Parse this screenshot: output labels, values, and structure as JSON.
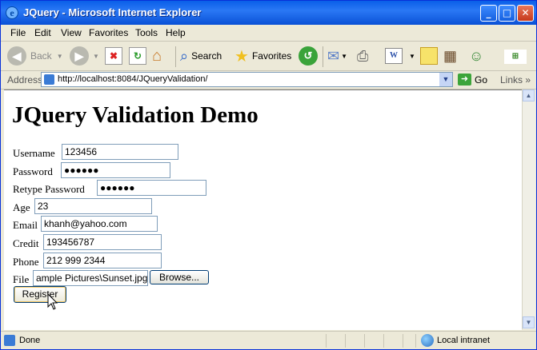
{
  "window": {
    "title": "JQuery - Microsoft Internet Explorer"
  },
  "menubar": {
    "items": [
      "File",
      "Edit",
      "View",
      "Favorites",
      "Tools",
      "Help"
    ]
  },
  "toolbar": {
    "back_label": "Back",
    "search_label": "Search",
    "favorites_label": "Favorites"
  },
  "addressbar": {
    "label": "Address",
    "url": "http://localhost:8084/JQueryValidation/",
    "go_label": "Go",
    "links_label": "Links"
  },
  "page": {
    "heading": "JQuery Validation Demo",
    "fields": [
      {
        "label": "Username",
        "value": "123456"
      },
      {
        "label": "Password",
        "value": "●●●●●●"
      },
      {
        "label": "Retype Password",
        "value": "●●●●●●"
      },
      {
        "label": "Age",
        "value": "23"
      },
      {
        "label": "Email",
        "value": "khanh@yahoo.com"
      },
      {
        "label": "Credit",
        "value": "193456787"
      },
      {
        "label": "Phone",
        "value": "212 999 2344"
      }
    ],
    "file": {
      "label": "File",
      "value": "ample Pictures\\Sunset.jpg",
      "browse_label": "Browse..."
    },
    "register_label": "Register"
  },
  "statusbar": {
    "status": "Done",
    "zone": "Local intranet"
  }
}
